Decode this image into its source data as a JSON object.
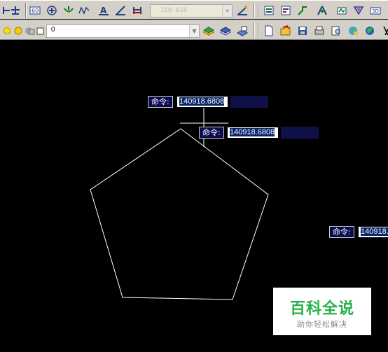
{
  "toolbar_top": {
    "dimstyle_combo": {
      "value": "ISO-010",
      "arrow": "▼"
    },
    "buttons": [
      "dim-linear-icon",
      "dim-aligned-icon",
      "dim-baseline-icon",
      "dim-center-icon",
      "dim-tolerance-icon",
      "dim-break-icon",
      "dim-text-edit-icon",
      "dim-edit-icon",
      "dim-update-icon",
      "dim-style-icon",
      "dim-properties-icon",
      "dim-leader-icon",
      "dim-jog-icon",
      "dim-space-icon",
      "dim-inspect-icon",
      "dim-override-icon"
    ]
  },
  "toolbar_layers": {
    "layer_combo": {
      "value": "0",
      "arrow": "▼"
    },
    "buttons": [
      "layer-properties-icon",
      "layer-previous-icon",
      "layer-match-icon",
      "new-file-icon",
      "open-file-icon",
      "save-icon",
      "plot-icon",
      "plot-preview-icon",
      "publish-icon",
      "web-icon",
      "cut-icon"
    ]
  },
  "dynamic_input": {
    "primary": {
      "label": "命令:",
      "value": "140918.6808"
    },
    "secondary": {
      "label": "命令:",
      "value": "140918.6808"
    },
    "edge": {
      "label": "命令:",
      "value": "140918."
    }
  },
  "drawing": {
    "shape": "pentagon",
    "stroke_color": "#ffffff",
    "background_color": "#000000"
  },
  "watermark": {
    "title": "百科全说",
    "subtitle": "助你轻松解决",
    "title_color": "#25b04a"
  }
}
